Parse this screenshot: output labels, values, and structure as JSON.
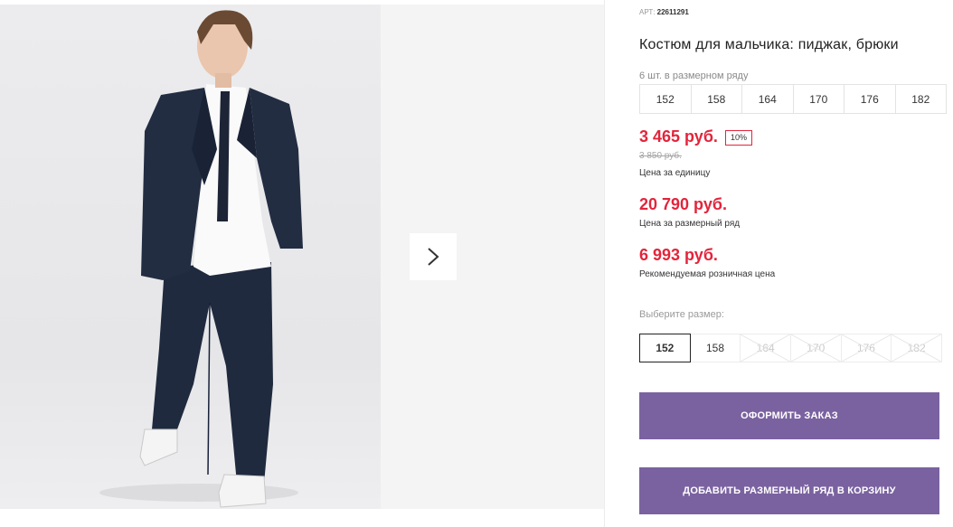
{
  "product": {
    "article_label": "АРТ:",
    "article_number": "22611291",
    "title": "Костюм для мальчика: пиджак, брюки"
  },
  "size_range": {
    "quantity_text": "6 шт. в размерном ряду",
    "sizes": [
      "152",
      "158",
      "164",
      "170",
      "176",
      "182"
    ]
  },
  "pricing": {
    "unit_price": "3 465 руб.",
    "discount_badge": "10%",
    "old_price": "3 850 руб.",
    "unit_price_note": "Цена за единицу",
    "range_price": "20 790 руб.",
    "range_price_note": "Цена за размерный ряд",
    "retail_price": "6 993 руб.",
    "retail_price_note": "Рекомендуемая розничная цена"
  },
  "size_picker": {
    "label": "Выберите размер:",
    "options": [
      {
        "size": "152",
        "state": "selected"
      },
      {
        "size": "158",
        "state": "available"
      },
      {
        "size": "164",
        "state": "unavailable"
      },
      {
        "size": "170",
        "state": "unavailable"
      },
      {
        "size": "176",
        "state": "unavailable"
      },
      {
        "size": "182",
        "state": "unavailable"
      }
    ]
  },
  "actions": {
    "checkout_label": "ОФОРМИТЬ ЗАКАЗ",
    "add_range_label": "ДОБАВИТЬ РАЗМЕРНЫЙ РЯД В КОРЗИНУ"
  },
  "gallery": {
    "next_icon": "chevron-right-icon"
  },
  "colors": {
    "price_red": "#e3243b",
    "button_purple": "#7a62a0"
  }
}
